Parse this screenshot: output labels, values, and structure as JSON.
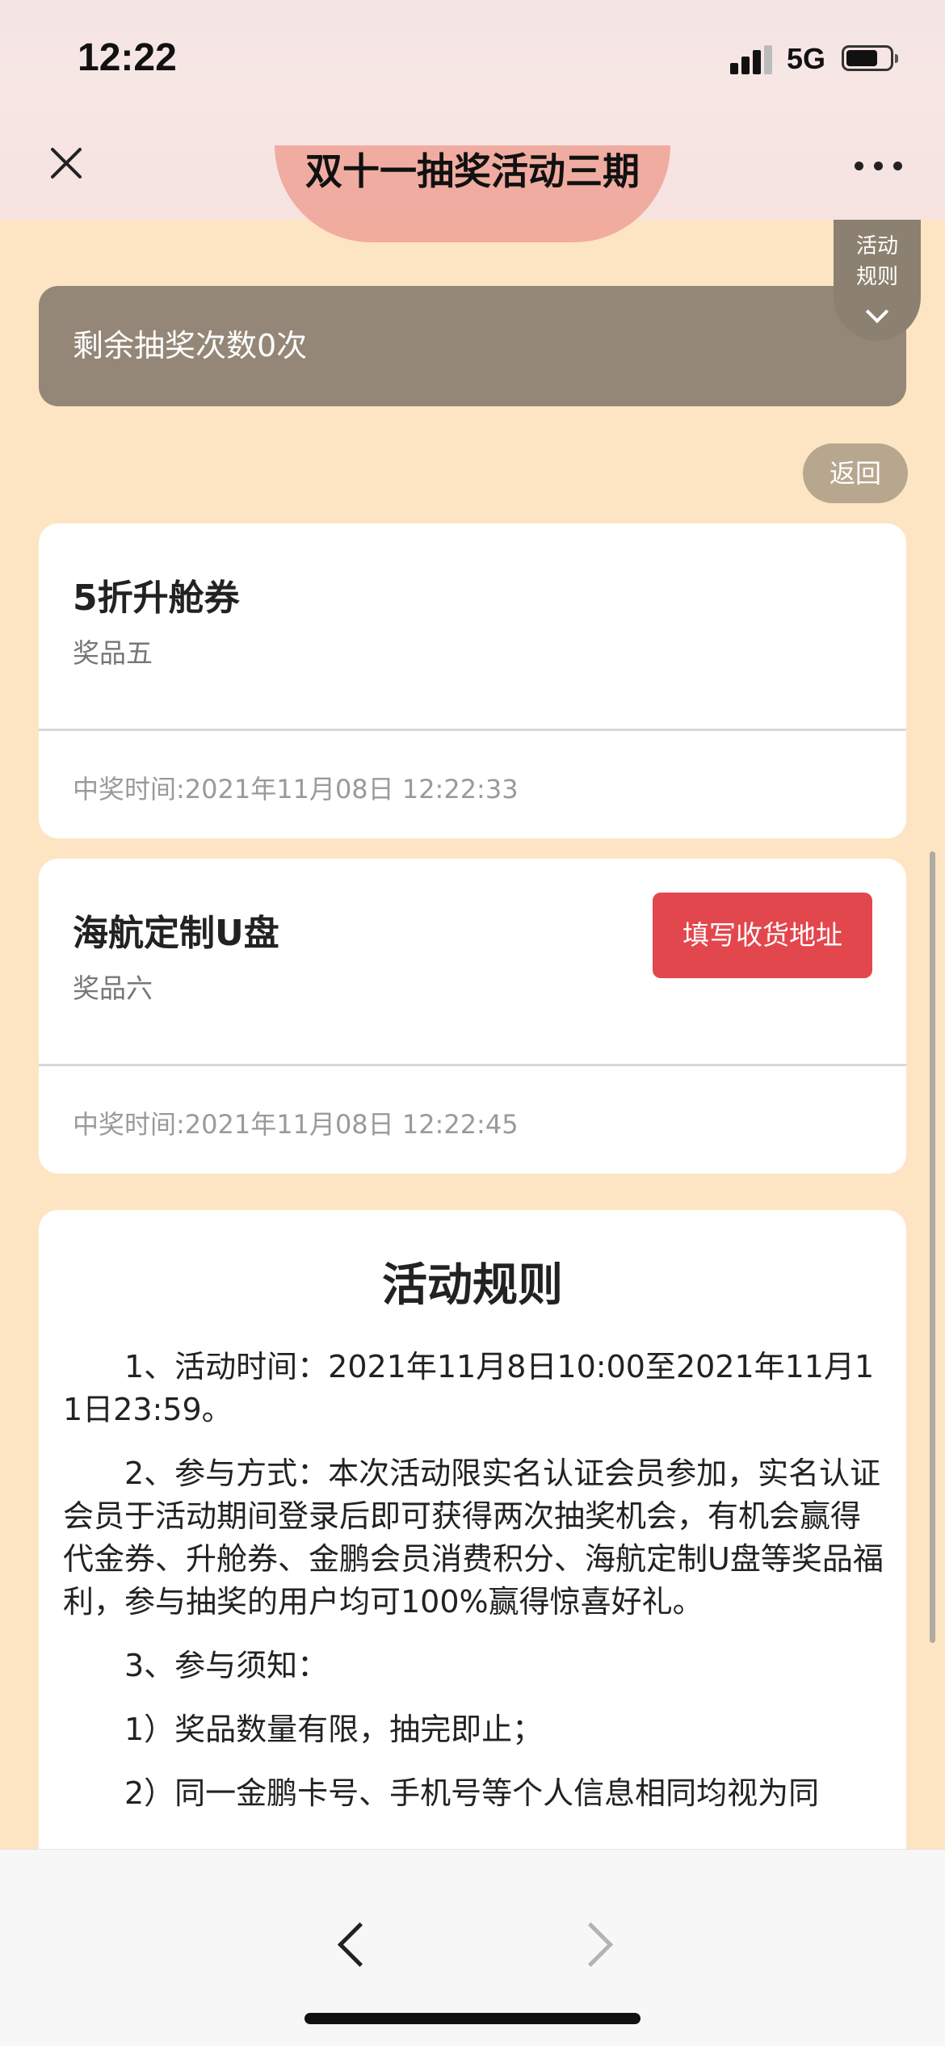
{
  "status_bar": {
    "time": "12:22",
    "network": "5G"
  },
  "header": {
    "title": "双十一抽奖活动三期"
  },
  "rules_tab": {
    "label": "活动规则"
  },
  "remaining": {
    "text": "剩余抽奖次数0次"
  },
  "back_button": {
    "label": "返回"
  },
  "prizes": [
    {
      "name": "5折升舱券",
      "level": "奖品五",
      "win_time": "中奖时间:2021年11月08日 12:22:33"
    },
    {
      "name": "海航定制U盘",
      "level": "奖品六",
      "action_label": "填写收货地址",
      "win_time": "中奖时间:2021年11月08日 12:22:45"
    }
  ],
  "rules": {
    "title": "活动规则",
    "paragraphs": [
      "1、活动时间：2021年11月8日10:00至2021年11月11日23:59。",
      "2、参与方式：本次活动限实名认证会员参加，实名认证会员于活动期间登录后即可获得两次抽奖机会，有机会赢得代金券、升舱券、金鹏会员消费积分、海航定制U盘等奖品福利，参与抽奖的用户均可100%赢得惊喜好礼。",
      "3、参与须知：",
      "1）奖品数量有限，抽完即止；",
      "2）同一金鹏卡号、手机号等个人信息相同均视为同"
    ]
  },
  "colors": {
    "page_background": "#fde5c3",
    "banner": "#948777",
    "back_button": "#b7a78e",
    "address_button": "#e2474d"
  },
  "icons": {
    "close": "close-icon",
    "more": "more-dots-icon",
    "rules_chevron": "chevron-down-icon",
    "browser_back": "chevron-left-icon",
    "browser_forward": "chevron-right-icon"
  }
}
